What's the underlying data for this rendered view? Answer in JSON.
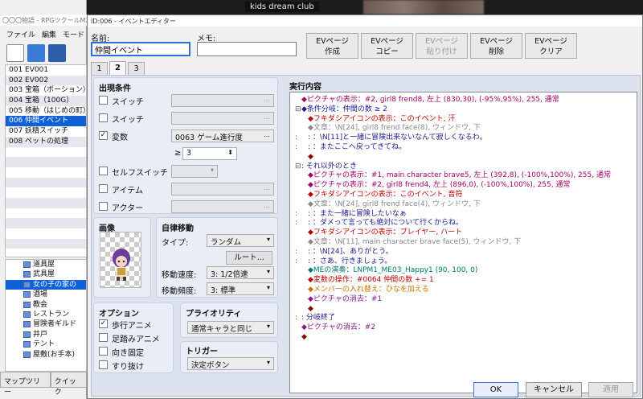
{
  "top": {
    "caption": "kids dream club"
  },
  "bg": {
    "title": "〇〇〇物語 - RPGツクールMZ",
    "menu": [
      "ファイル",
      "編集",
      "モード"
    ],
    "events": [
      "001 EV001",
      "002 EV002",
      "003 宝箱（ポーション）",
      "004 宝箱（100G）",
      "005 移動（はじめの町）",
      "006 仲間イベント",
      "007 妖精スイッチ",
      "008 ペットの処理"
    ],
    "maps": [
      "道具屋",
      "武具屋",
      "女の子の家の",
      "酒場",
      "教会",
      "レストラン",
      "冒険者ギルド",
      "井戸",
      "テント",
      "屋敷(お手本)"
    ],
    "tabs": [
      "マップツリー",
      "クイック"
    ]
  },
  "dialog": {
    "title": "ID:006 - イベントエディター",
    "name_label": "名前:",
    "name_value": "仲間イベント",
    "memo_label": "メモ:",
    "memo_value": "",
    "ev_buttons": [
      "EVページ\n作成",
      "EVページ\nコピー",
      "EVページ\n貼り付け",
      "EVページ\n削除",
      "EVページ\nクリア"
    ],
    "page_tabs": [
      "1",
      "2",
      "3"
    ],
    "conditions": {
      "title": "出現条件",
      "switch1": "スイッチ",
      "switch2": "スイッチ",
      "variable": "変数",
      "variable_value": "0063 ゲーム進行度",
      "ge": "≥",
      "number": "3",
      "self_switch": "セルフスイッチ",
      "item": "アイテム",
      "actor": "アクター",
      "ellipsis": "..."
    },
    "image": {
      "title": "画像"
    },
    "autonomous": {
      "title": "自律移動",
      "type_label": "タイプ:",
      "type_value": "ランダム",
      "route": "ルート...",
      "speed_label": "移動速度:",
      "speed_value": "3: 1/2倍速",
      "freq_label": "移動頻度:",
      "freq_value": "3: 標準"
    },
    "options": {
      "title": "オプション",
      "items": [
        "歩行アニメ",
        "足踏みアニメ",
        "向き固定",
        "すり抜け"
      ],
      "checked": [
        true,
        false,
        false,
        false
      ]
    },
    "priority": {
      "title": "プライオリティ",
      "value": "通常キャラと同じ"
    },
    "trigger": {
      "title": "トリガー",
      "value": "決定ボタン"
    },
    "content_title": "実行内容",
    "lines": [
      {
        "p": "",
        "t": "◆ピクチャの表示：#2, girl8 frend8, 左上 (830,30), (-95%,95%), 255, 通常",
        "c": "c-pic",
        "i": 1
      },
      {
        "p": "⊟",
        "t": "◆条件分岐：仲間の数 ≥ 2",
        "c": "c-cond",
        "i": 1
      },
      {
        "p": "",
        "t": "◆フキダシアイコンの表示：このイベント, 汗",
        "c": "c-red",
        "i": 2
      },
      {
        "p": "",
        "t": "◆文章：\\N[24], girl8 frend face(8), ウィンドウ, 下",
        "c": "c-gry",
        "i": 2
      },
      {
        "p": ":",
        "t": ":      ：\\N[11]と一緒に冒険出来ないなんて寂しくなるわ。",
        "c": "c-nav",
        "i": 2
      },
      {
        "p": ":",
        "t": ":      ：またここへ戻ってきてね。",
        "c": "c-nav",
        "i": 2
      },
      {
        "p": "",
        "t": "◆",
        "c": "dia",
        "i": 2
      },
      {
        "p": "⊟",
        "t": ": それ以外のとき",
        "c": "c-cond",
        "i": 1
      },
      {
        "p": "",
        "t": "◆ピクチャの表示：#1, main character brave5, 左上 (392,8), (-100%,100%), 255, 通常",
        "c": "c-pic",
        "i": 2
      },
      {
        "p": "",
        "t": "◆ピクチャの表示：#2, girl8 frend4, 左上 (896,0), (-100%,100%), 255, 通常",
        "c": "c-pic",
        "i": 2
      },
      {
        "p": "",
        "t": "◆フキダシアイコンの表示：このイベント, 音符",
        "c": "c-red",
        "i": 2
      },
      {
        "p": "",
        "t": "◆文章：\\N[24], girl8 frend face(4), ウィンドウ, 下",
        "c": "c-gry",
        "i": 2
      },
      {
        "p": ":",
        "t": ":      ：また一緒に冒険したいなぁ",
        "c": "c-nav",
        "i": 2
      },
      {
        "p": ":",
        "t": ":      ：ダメって言っても絶対について行くからね。",
        "c": "c-nav",
        "i": 2
      },
      {
        "p": "",
        "t": "◆フキダシアイコンの表示：プレイヤー, ハート",
        "c": "c-red",
        "i": 2
      },
      {
        "p": "",
        "t": "◆文章：\\N[11], main character brave face(5), ウィンドウ, 下",
        "c": "c-gry",
        "i": 2
      },
      {
        "p": ":",
        "t": ":      ：\\N[24]、ありがとう。",
        "c": "c-nav",
        "i": 2
      },
      {
        "p": ":",
        "t": ":      ：さあ、行きましょう。",
        "c": "c-nav",
        "i": 2
      },
      {
        "p": "",
        "t": "◆MEの演奏：LNPM1_ME03_Happy1 (90, 100, 0)",
        "c": "c-tel",
        "i": 2
      },
      {
        "p": "",
        "t": "◆変数の操作：#0064 仲間の数 += 1",
        "c": "c-red",
        "i": 2
      },
      {
        "p": "",
        "t": "◆メンバーの入れ替え：ひなを加える",
        "c": "c-org",
        "i": 2
      },
      {
        "p": "",
        "t": "◆ピクチャの消去：#1",
        "c": "c-prp",
        "i": 2
      },
      {
        "p": "",
        "t": "◆",
        "c": "dia",
        "i": 2
      },
      {
        "p": ":",
        "t": ": 分岐終了",
        "c": "c-cond",
        "i": 1
      },
      {
        "p": "",
        "t": "◆ピクチャの消去：#2",
        "c": "c-prp",
        "i": 1
      },
      {
        "p": "",
        "t": "◆",
        "c": "dia",
        "i": 1
      }
    ],
    "ok": "OK",
    "cancel": "キャンセル",
    "apply": "適用"
  }
}
